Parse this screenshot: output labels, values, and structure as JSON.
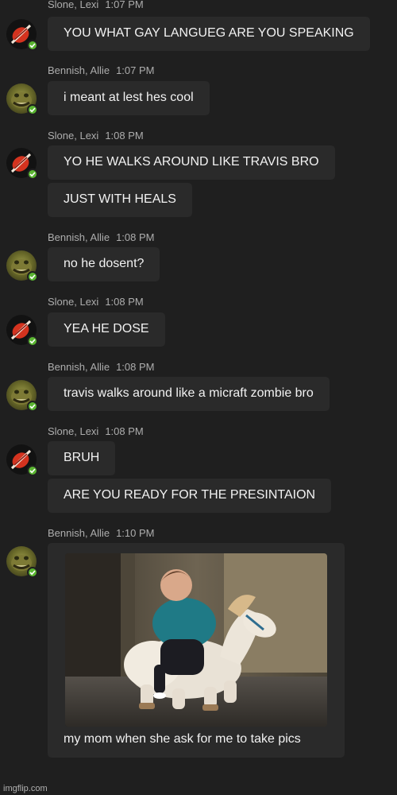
{
  "users": {
    "lexi": "Slone, Lexi",
    "allie": "Bennish, Allie"
  },
  "messages": [
    {
      "sender": "Slone, Lexi",
      "time": "1:07 PM",
      "lines": [
        "YOU WHAT GAY LANGUEG ARE YOU SPEAKING"
      ]
    },
    {
      "sender": "Bennish, Allie",
      "time": "1:07 PM",
      "lines": [
        "i meant at lest hes cool"
      ]
    },
    {
      "sender": "Slone, Lexi",
      "time": "1:08 PM",
      "lines": [
        "YO HE WALKS AROUND LIKE TRAVIS BRO",
        "JUST WITH HEALS"
      ]
    },
    {
      "sender": "Bennish, Allie",
      "time": "1:08 PM",
      "lines": [
        "no he dosent?"
      ]
    },
    {
      "sender": "Slone, Lexi",
      "time": "1:08 PM",
      "lines": [
        "YEA HE DOSE"
      ]
    },
    {
      "sender": "Bennish, Allie",
      "time": "1:08 PM",
      "lines": [
        "travis walks around like a micraft zombie bro"
      ]
    },
    {
      "sender": "Slone, Lexi",
      "time": "1:08 PM",
      "lines": [
        "BRUH",
        "ARE YOU READY FOR THE PRESINTAION"
      ]
    },
    {
      "sender": "Bennish, Allie",
      "time": "1:10 PM",
      "lines": [
        "my mom when she ask for me to take pics"
      ],
      "has_image": true
    }
  ],
  "status_color": "#5ab531",
  "watermark": "imgflip.com"
}
